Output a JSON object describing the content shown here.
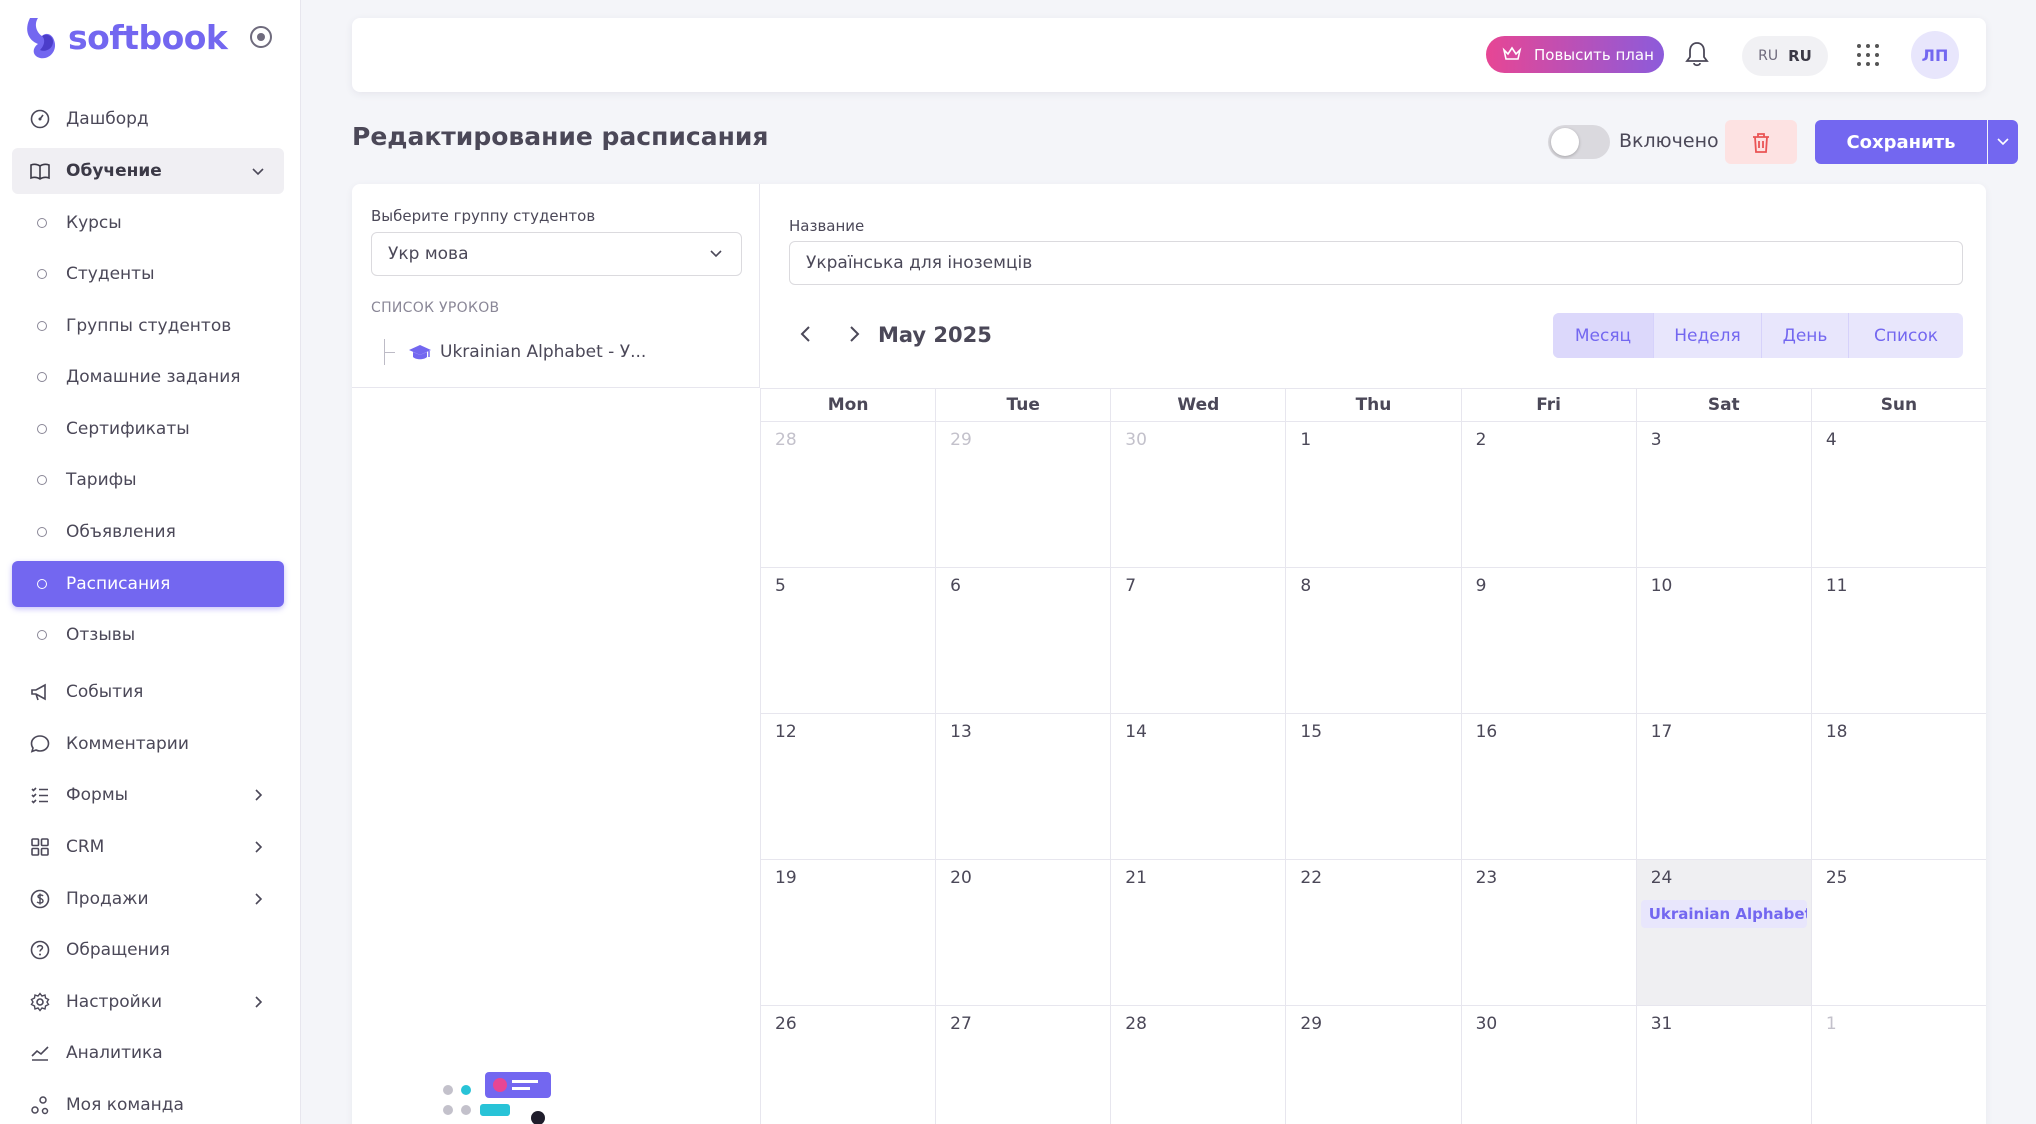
{
  "brand": {
    "name": "softbook",
    "accent": "#7367f0"
  },
  "sidebar": {
    "items": [
      {
        "label": "Дашборд",
        "icon": "dashboard-icon"
      },
      {
        "label": "Обучение",
        "icon": "book-icon"
      },
      {
        "label": "Курсы"
      },
      {
        "label": "Студенты"
      },
      {
        "label": "Группы студентов"
      },
      {
        "label": "Домашние задания"
      },
      {
        "label": "Сертификаты"
      },
      {
        "label": "Тарифы"
      },
      {
        "label": "Объявления"
      },
      {
        "label": "Расписания"
      },
      {
        "label": "Отзывы"
      },
      {
        "label": "События",
        "icon": "megaphone-icon"
      },
      {
        "label": "Комментарии",
        "icon": "comment-icon"
      },
      {
        "label": "Формы",
        "icon": "list-check-icon"
      },
      {
        "label": "CRM",
        "icon": "grid-icon"
      },
      {
        "label": "Продажи",
        "icon": "dollar-icon"
      },
      {
        "label": "Обращения",
        "icon": "help-icon"
      },
      {
        "label": "Настройки",
        "icon": "gear-icon"
      },
      {
        "label": "Аналитика",
        "icon": "chart-icon"
      },
      {
        "label": "Моя команда",
        "icon": "team-icon"
      }
    ]
  },
  "topbar": {
    "upgrade_label": "Повысить план",
    "lang_small": "RU",
    "lang_main": "RU",
    "avatar_initials": "ЛП"
  },
  "page": {
    "title": "Редактирование расписания",
    "toggle_label": "Включено",
    "save_label": "Сохранить"
  },
  "left_panel": {
    "group_label": "Выберите группу студентов",
    "group_value": "Укр мова",
    "lessons_label": "СПИСОК УРОКОВ",
    "lessons": [
      "Ukrainian Alphabet - У..."
    ]
  },
  "form": {
    "name_label": "Название",
    "name_value": "Українська для іноземців"
  },
  "calendar": {
    "title": "May 2025",
    "views": [
      "Месяц",
      "Неделя",
      "День",
      "Список"
    ],
    "selected_view": "Месяц",
    "weekdays": [
      "Mon",
      "Tue",
      "Wed",
      "Thu",
      "Fri",
      "Sat",
      "Sun"
    ],
    "weeks": [
      [
        "28",
        "29",
        "30",
        "1",
        "2",
        "3",
        "4"
      ],
      [
        "5",
        "6",
        "7",
        "8",
        "9",
        "10",
        "11"
      ],
      [
        "12",
        "13",
        "14",
        "15",
        "16",
        "17",
        "18"
      ],
      [
        "19",
        "20",
        "21",
        "22",
        "23",
        "24",
        "25"
      ],
      [
        "26",
        "27",
        "28",
        "29",
        "30",
        "31",
        "1"
      ]
    ],
    "today": "24",
    "event": {
      "day": "24",
      "title": "Ukrainian Alphabet"
    }
  }
}
